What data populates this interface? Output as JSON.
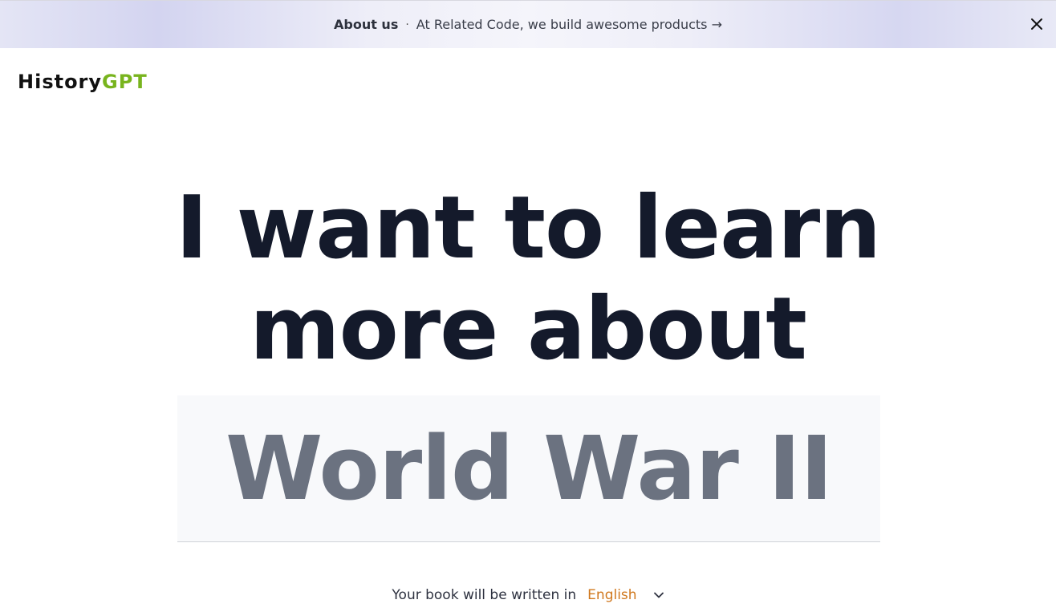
{
  "banner": {
    "about_label": "About us",
    "separator": "·",
    "message": "At Related Code, we build awesome products →",
    "close_icon": "close-icon"
  },
  "brand": {
    "name_part1": "History",
    "name_part2": "GPT",
    "accent_color": "#78b41e"
  },
  "hero": {
    "line1": "I want to learn",
    "line2": "more about"
  },
  "topic_input": {
    "value": "World War II"
  },
  "language": {
    "prefix": "Your book will be written in",
    "selected": "English",
    "selected_color": "#d0781e",
    "dropdown_icon": "chevron-down-icon"
  }
}
